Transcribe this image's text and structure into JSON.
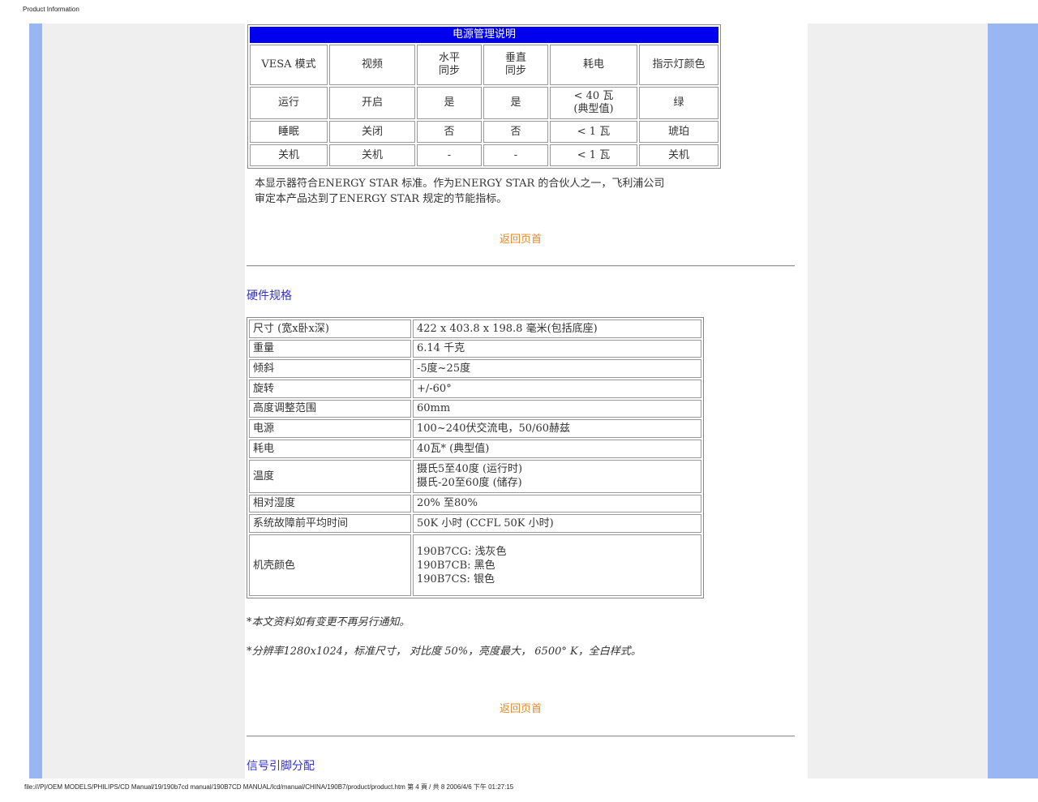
{
  "page_header": "Product Information",
  "footer": "file:///P|/OEM MODELS/PHILIPS/CD Manual/19/190b7cd manual/190B7CD MANUAL/lcd/manual/CHINA/190B7/product/product.htm 第 4 頁 / 共 8 2006/4/6 下午 01:27:15",
  "power_table": {
    "title": "电源管理说明",
    "headers": [
      "VESA 模式",
      "视频",
      "水平\n同步",
      "垂直\n同步",
      "耗电",
      "指示灯颜色"
    ],
    "rows": [
      [
        "运行",
        "开启",
        "是",
        "是",
        "< 40 瓦\n(典型值)",
        "绿"
      ],
      [
        "睡眠",
        "关闭",
        "否",
        "否",
        "< 1 瓦",
        "琥珀"
      ],
      [
        "关机",
        "关机",
        "-",
        "-",
        "< 1 瓦",
        "关机"
      ]
    ]
  },
  "energy_star_text": "本显示器符合ENERGY STAR  标准。作为ENERGY STAR  的合伙人之一，飞利浦公司\n审定本产品达到了ENERGY STAR  规定的节能指标。",
  "back_to_top": "返回页首",
  "hardware_title": "硬件规格",
  "spec_rows": [
    {
      "label": "尺寸 (宽x卧x深)",
      "value": "422 x 403.8 x 198.8 毫米(包括底座)"
    },
    {
      "label": "重量",
      "value": "6.14 千克"
    },
    {
      "label": "倾斜",
      "value": "-5度~25度"
    },
    {
      "label": "旋转",
      "value": "+/-60°"
    },
    {
      "label": "高度调整范围",
      "value": "60mm"
    },
    {
      "label": "电源",
      "value": "100~240伏交流电，50/60赫兹"
    },
    {
      "label": "耗电",
      "value": "40瓦* (典型值)"
    },
    {
      "label": "温度",
      "value": "摄氏5至40度 (运行时)\n摄氏-20至60度 (储存)"
    },
    {
      "label": "相对湿度",
      "value": "20% 至80%"
    },
    {
      "label": "系统故障前平均时间",
      "value": "50K 小时 (CCFL 50K 小时)"
    },
    {
      "label": "机壳颜色",
      "value": "190B7CG: 浅灰色\n190B7CB: 黑色\n190B7CS: 银色"
    }
  ],
  "note1": "*本文资料如有变更不再另行通知。",
  "note2": "*分辨率1280x1024，标准尺寸， 对比度 50%，亮度最大， 6500° K，全白样式。",
  "pin_title": "信号引脚分配"
}
